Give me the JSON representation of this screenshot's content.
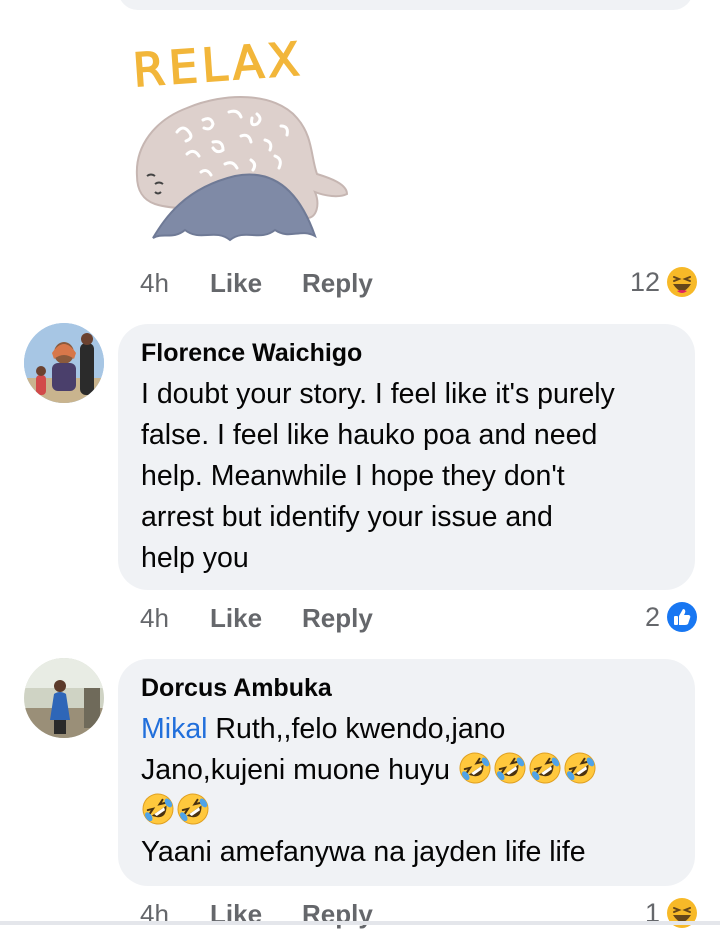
{
  "sticker": {
    "text": "RELAX"
  },
  "comments": [
    {
      "time": "4h",
      "like": "Like",
      "reply": "Reply",
      "reaction_count": "12",
      "reaction_icon": "haha-icon"
    },
    {
      "author": "Florence Waichigo",
      "lines": [
        "I doubt your story. I feel like it's purely",
        "false. I feel like hauko poa and need",
        "help. Meanwhile I hope they don't",
        "arrest but identify your issue and",
        "help you"
      ],
      "time": "4h",
      "like": "Like",
      "reply": "Reply",
      "reaction_count": "2",
      "reaction_icon": "like-icon"
    },
    {
      "author": "Dorcus Ambuka",
      "mention": "Mikal",
      "line1_rest": " Ruth,,felo kwendo,jano",
      "line2": "Jano,kujeni muone huyu ",
      "line4": "Yaani amefanywa na jayden life life",
      "emoji": "rolling-on-floor-laughing",
      "time": "4h",
      "like": "Like",
      "reply": "Reply",
      "reaction_count": "1",
      "reaction_icon": "haha-icon"
    }
  ],
  "colors": {
    "bubble": "#f0f2f5",
    "meta": "#65676b",
    "mention": "#216fdb",
    "like_blue": "#1877f2",
    "haha_yellow": "#f7b928"
  }
}
